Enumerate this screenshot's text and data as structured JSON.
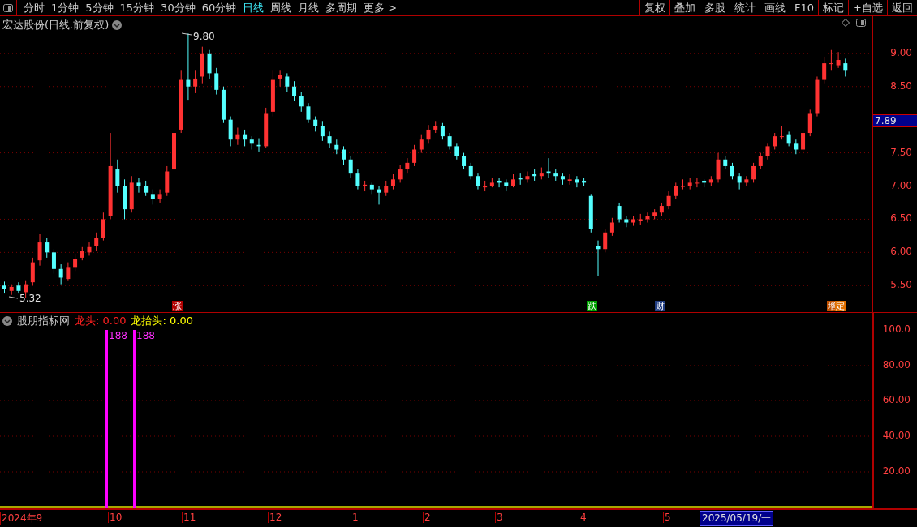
{
  "toolbar": {
    "periods": [
      {
        "label": "分时",
        "selected": false
      },
      {
        "label": "1分钟",
        "selected": false
      },
      {
        "label": "5分钟",
        "selected": false
      },
      {
        "label": "15分钟",
        "selected": false
      },
      {
        "label": "30分钟",
        "selected": false
      },
      {
        "label": "60分钟",
        "selected": false
      },
      {
        "label": "日线",
        "selected": true
      },
      {
        "label": "周线",
        "selected": false
      },
      {
        "label": "月线",
        "selected": false
      },
      {
        "label": "多周期",
        "selected": false
      },
      {
        "label": "更多 >",
        "selected": false
      }
    ],
    "actions": [
      "复权",
      "叠加",
      "多股",
      "统计",
      "画线",
      "F10",
      "标记",
      "+自选",
      "返回"
    ]
  },
  "main_chart": {
    "title": "宏达股份(日线.前复权)",
    "high_label": "9.80",
    "low_label": "5.32",
    "chart_data": {
      "type": "candlestick",
      "ohlc": [
        [
          5.5,
          5.56,
          5.38,
          5.45
        ],
        [
          5.42,
          5.52,
          5.36,
          5.48
        ],
        [
          5.5,
          5.55,
          5.38,
          5.42
        ],
        [
          5.4,
          5.58,
          5.32,
          5.52
        ],
        [
          5.55,
          5.92,
          5.5,
          5.85
        ],
        [
          5.88,
          6.28,
          5.8,
          6.15
        ],
        [
          6.15,
          6.22,
          5.92,
          6.0
        ],
        [
          6.0,
          6.05,
          5.68,
          5.75
        ],
        [
          5.75,
          5.82,
          5.52,
          5.62
        ],
        [
          5.6,
          5.85,
          5.58,
          5.78
        ],
        [
          5.78,
          5.98,
          5.72,
          5.9
        ],
        [
          5.92,
          6.08,
          5.88,
          6.02
        ],
        [
          6.0,
          6.15,
          5.95,
          6.08
        ],
        [
          6.1,
          6.3,
          6.02,
          6.22
        ],
        [
          6.22,
          6.6,
          6.18,
          6.5
        ],
        [
          6.55,
          7.8,
          6.5,
          7.3
        ],
        [
          7.25,
          7.4,
          6.9,
          7.0
        ],
        [
          7.0,
          7.1,
          6.5,
          6.65
        ],
        [
          6.65,
          7.15,
          6.6,
          7.05
        ],
        [
          7.05,
          7.12,
          6.9,
          7.0
        ],
        [
          7.0,
          7.08,
          6.85,
          6.9
        ],
        [
          6.88,
          6.95,
          6.72,
          6.8
        ],
        [
          6.8,
          6.95,
          6.75,
          6.88
        ],
        [
          6.9,
          7.3,
          6.85,
          7.22
        ],
        [
          7.25,
          7.9,
          7.2,
          7.8
        ],
        [
          7.85,
          8.75,
          7.8,
          8.6
        ],
        [
          8.6,
          9.3,
          8.3,
          8.5
        ],
        [
          8.5,
          8.75,
          8.4,
          8.62
        ],
        [
          8.65,
          9.1,
          8.55,
          9.0
        ],
        [
          9.0,
          9.05,
          8.62,
          8.7
        ],
        [
          8.7,
          8.78,
          8.38,
          8.45
        ],
        [
          8.45,
          8.5,
          7.95,
          8.0
        ],
        [
          8.0,
          8.05,
          7.6,
          7.7
        ],
        [
          7.7,
          7.88,
          7.62,
          7.78
        ],
        [
          7.78,
          7.85,
          7.6,
          7.7
        ],
        [
          7.7,
          7.75,
          7.55,
          7.65
        ],
        [
          7.62,
          7.72,
          7.52,
          7.6
        ],
        [
          7.6,
          8.18,
          7.58,
          8.1
        ],
        [
          8.12,
          8.75,
          8.05,
          8.6
        ],
        [
          8.62,
          8.75,
          8.5,
          8.68
        ],
        [
          8.65,
          8.7,
          8.42,
          8.5
        ],
        [
          8.5,
          8.58,
          8.28,
          8.35
        ],
        [
          8.35,
          8.42,
          8.12,
          8.2
        ],
        [
          8.2,
          8.25,
          7.95,
          8.0
        ],
        [
          8.0,
          8.05,
          7.82,
          7.9
        ],
        [
          7.9,
          7.98,
          7.68,
          7.75
        ],
        [
          7.75,
          7.82,
          7.58,
          7.65
        ],
        [
          7.62,
          7.7,
          7.48,
          7.55
        ],
        [
          7.55,
          7.6,
          7.32,
          7.4
        ],
        [
          7.4,
          7.45,
          7.12,
          7.2
        ],
        [
          7.2,
          7.25,
          6.95,
          7.0
        ],
        [
          7.0,
          7.08,
          6.92,
          7.02
        ],
        [
          7.02,
          7.05,
          6.88,
          6.95
        ],
        [
          6.95,
          7.0,
          6.72,
          6.9
        ],
        [
          6.9,
          7.08,
          6.85,
          7.0
        ],
        [
          7.0,
          7.18,
          6.95,
          7.1
        ],
        [
          7.1,
          7.32,
          7.05,
          7.25
        ],
        [
          7.25,
          7.42,
          7.2,
          7.35
        ],
        [
          7.35,
          7.62,
          7.3,
          7.55
        ],
        [
          7.55,
          7.78,
          7.5,
          7.7
        ],
        [
          7.7,
          7.92,
          7.65,
          7.85
        ],
        [
          7.85,
          7.98,
          7.8,
          7.9
        ],
        [
          7.9,
          7.95,
          7.7,
          7.75
        ],
        [
          7.75,
          7.8,
          7.55,
          7.6
        ],
        [
          7.6,
          7.65,
          7.4,
          7.45
        ],
        [
          7.45,
          7.5,
          7.25,
          7.3
        ],
        [
          7.3,
          7.35,
          7.1,
          7.15
        ],
        [
          7.15,
          7.2,
          6.95,
          7.0
        ],
        [
          6.98,
          7.08,
          6.92,
          7.0
        ],
        [
          7.0,
          7.12,
          6.98,
          7.05
        ],
        [
          7.08,
          7.12,
          6.98,
          7.05
        ],
        [
          7.05,
          7.1,
          6.92,
          7.0
        ],
        [
          7.0,
          7.18,
          6.98,
          7.1
        ],
        [
          7.12,
          7.2,
          7.02,
          7.1
        ],
        [
          7.1,
          7.22,
          7.05,
          7.15
        ],
        [
          7.18,
          7.25,
          7.08,
          7.15
        ],
        [
          7.15,
          7.28,
          7.1,
          7.2
        ],
        [
          7.22,
          7.42,
          7.12,
          7.2
        ],
        [
          7.2,
          7.25,
          7.08,
          7.15
        ],
        [
          7.15,
          7.2,
          7.02,
          7.1
        ],
        [
          7.08,
          7.18,
          7.02,
          7.1
        ],
        [
          7.1,
          7.15,
          6.98,
          7.05
        ],
        [
          7.08,
          7.12,
          7.0,
          7.05
        ],
        [
          6.85,
          6.88,
          6.3,
          6.35
        ],
        [
          6.1,
          6.18,
          5.65,
          6.05
        ],
        [
          6.05,
          6.35,
          6.0,
          6.3
        ],
        [
          6.3,
          6.52,
          6.25,
          6.45
        ],
        [
          6.7,
          6.75,
          6.45,
          6.5
        ],
        [
          6.5,
          6.55,
          6.38,
          6.45
        ],
        [
          6.45,
          6.55,
          6.4,
          6.5
        ],
        [
          6.48,
          6.58,
          6.42,
          6.5
        ],
        [
          6.5,
          6.6,
          6.45,
          6.55
        ],
        [
          6.55,
          6.65,
          6.5,
          6.6
        ],
        [
          6.6,
          6.75,
          6.55,
          6.7
        ],
        [
          6.7,
          6.92,
          6.65,
          6.85
        ],
        [
          6.85,
          7.05,
          6.8,
          7.0
        ],
        [
          7.0,
          7.1,
          6.95,
          7.0
        ],
        [
          7.0,
          7.12,
          6.95,
          7.05
        ],
        [
          7.05,
          7.12,
          6.98,
          7.05
        ],
        [
          7.08,
          7.1,
          6.98,
          7.05
        ],
        [
          7.05,
          7.15,
          7.0,
          7.1
        ],
        [
          7.1,
          7.5,
          7.05,
          7.4
        ],
        [
          7.4,
          7.45,
          7.25,
          7.3
        ],
        [
          7.3,
          7.35,
          7.1,
          7.15
        ],
        [
          7.15,
          7.2,
          6.95,
          7.05
        ],
        [
          7.05,
          7.15,
          7.0,
          7.1
        ],
        [
          7.1,
          7.35,
          7.05,
          7.3
        ],
        [
          7.3,
          7.5,
          7.25,
          7.45
        ],
        [
          7.45,
          7.65,
          7.4,
          7.6
        ],
        [
          7.6,
          7.8,
          7.55,
          7.75
        ],
        [
          7.75,
          7.9,
          7.7,
          7.75
        ],
        [
          7.78,
          7.82,
          7.6,
          7.65
        ],
        [
          7.65,
          7.7,
          7.48,
          7.55
        ],
        [
          7.55,
          7.85,
          7.5,
          7.8
        ],
        [
          7.8,
          8.15,
          7.75,
          8.1
        ],
        [
          8.1,
          8.65,
          8.05,
          8.6
        ],
        [
          8.6,
          8.95,
          8.55,
          8.85
        ],
        [
          8.85,
          9.05,
          8.75,
          8.85
        ],
        [
          8.82,
          9.02,
          8.78,
          8.9
        ],
        [
          8.85,
          8.92,
          8.65,
          8.75
        ]
      ],
      "ylim": [
        5.1,
        9.56
      ],
      "grid": true,
      "yticks": [
        {
          "value": 9,
          "label": "9.00"
        },
        {
          "value": 8.5,
          "label": "8.50"
        },
        {
          "value": 7.5,
          "label": "7.50"
        },
        {
          "value": 7,
          "label": "7.00"
        },
        {
          "value": 6.5,
          "label": "6.50"
        },
        {
          "value": 6,
          "label": "6.00"
        },
        {
          "value": 5.5,
          "label": "5.50"
        }
      ]
    },
    "current_price": "7.89",
    "event_markers": [
      {
        "label": "涨",
        "color": "#b00000"
      },
      {
        "label": "跌",
        "color": "#00a000"
      },
      {
        "label": "财",
        "color": "#203c80"
      },
      {
        "label": "增",
        "color": "#c05000"
      },
      {
        "label": "定",
        "color": "#e07000"
      }
    ]
  },
  "indicator": {
    "name": "股朋指标网",
    "values": [
      {
        "text": "龙头: 0.00",
        "color": "#ff2020"
      },
      {
        "text": "龙抬头: 0.00",
        "color": "#ffff00"
      }
    ],
    "signals": [
      {
        "label": "188"
      },
      {
        "label": "188"
      }
    ],
    "axis": [
      "100.0",
      "80.00",
      "60.00",
      "40.00",
      "20.00"
    ]
  },
  "time_axis": {
    "months": [
      "2024年9",
      "10",
      "11",
      "12",
      "1",
      "2",
      "3",
      "4",
      "5"
    ],
    "cursor_date": "2025/05/19/一"
  }
}
